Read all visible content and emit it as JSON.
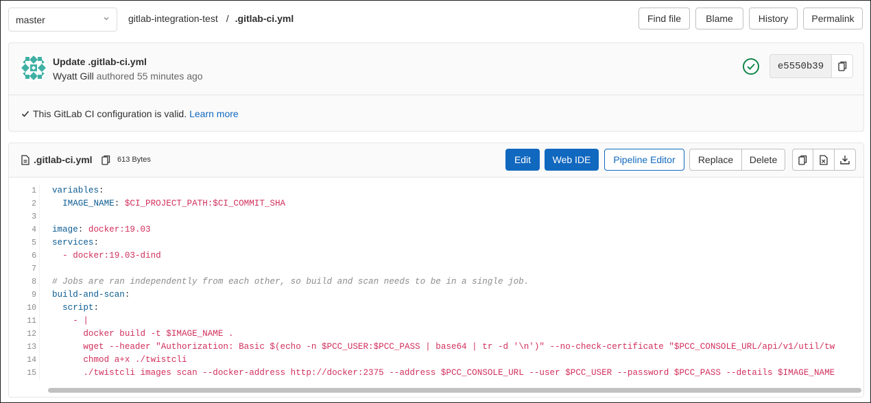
{
  "topbar": {
    "branch": "master",
    "project": "gitlab-integration-test",
    "separator": "/",
    "file": ".gitlab-ci.yml",
    "buttons": {
      "find_file": "Find file",
      "blame": "Blame",
      "history": "History",
      "permalink": "Permalink"
    }
  },
  "commit": {
    "title": "Update .gitlab-ci.yml",
    "author": "Wyatt Gill",
    "authored": "authored 55 minutes ago",
    "sha": "e5550b39",
    "status": "passed",
    "ci_valid": "This GitLab CI configuration is valid.",
    "learn_more": "Learn more",
    "avatar_color": "#3fb0a3"
  },
  "file": {
    "name": ".gitlab-ci.yml",
    "size": "613 Bytes",
    "buttons": {
      "edit": "Edit",
      "web_ide": "Web IDE",
      "pipeline_editor": "Pipeline Editor",
      "replace": "Replace",
      "delete": "Delete"
    },
    "icons": [
      "copy-contents-icon",
      "raw-file-icon",
      "download-icon"
    ]
  },
  "code_lines": [
    {
      "n": "1",
      "parts": [
        [
          "k",
          "variables"
        ],
        [
          "p",
          ":"
        ]
      ]
    },
    {
      "n": "2",
      "parts": [
        [
          "p",
          "  "
        ],
        [
          "k",
          "IMAGE_NAME"
        ],
        [
          "p",
          ": "
        ],
        [
          "v",
          "$CI_PROJECT_PATH:$CI_COMMIT_SHA"
        ]
      ]
    },
    {
      "n": "3",
      "parts": []
    },
    {
      "n": "4",
      "parts": [
        [
          "k",
          "image"
        ],
        [
          "p",
          ": "
        ],
        [
          "v",
          "docker:19.03"
        ]
      ]
    },
    {
      "n": "5",
      "parts": [
        [
          "k",
          "services"
        ],
        [
          "p",
          ":"
        ]
      ]
    },
    {
      "n": "6",
      "parts": [
        [
          "p",
          "  "
        ],
        [
          "v",
          "- docker:19.03-dind"
        ]
      ]
    },
    {
      "n": "7",
      "parts": []
    },
    {
      "n": "8",
      "parts": [
        [
          "c",
          "# Jobs are ran independently from each other, so build and scan needs to be in a single job."
        ]
      ]
    },
    {
      "n": "9",
      "parts": [
        [
          "k",
          "build-and-scan"
        ],
        [
          "p",
          ":"
        ]
      ]
    },
    {
      "n": "10",
      "parts": [
        [
          "p",
          "  "
        ],
        [
          "k",
          "script"
        ],
        [
          "p",
          ":"
        ]
      ]
    },
    {
      "n": "11",
      "parts": [
        [
          "p",
          "    "
        ],
        [
          "v",
          "- |"
        ]
      ]
    },
    {
      "n": "12",
      "parts": [
        [
          "p",
          "      "
        ],
        [
          "v",
          "docker build -t $IMAGE_NAME ."
        ]
      ]
    },
    {
      "n": "13",
      "parts": [
        [
          "p",
          "      "
        ],
        [
          "v",
          "wget --header \"Authorization: Basic $(echo -n $PCC_USER:$PCC_PASS | base64 | tr -d '\\n')\" --no-check-certificate \"$PCC_CONSOLE_URL/api/v1/util/tw"
        ]
      ]
    },
    {
      "n": "14",
      "parts": [
        [
          "p",
          "      "
        ],
        [
          "v",
          "chmod a+x ./twistcli"
        ]
      ]
    },
    {
      "n": "15",
      "parts": [
        [
          "p",
          "      "
        ],
        [
          "v",
          "./twistcli images scan --docker-address http://docker:2375 --address $PCC_CONSOLE_URL --user $PCC_USER --password $PCC_PASS --details $IMAGE_NAME"
        ]
      ]
    }
  ]
}
